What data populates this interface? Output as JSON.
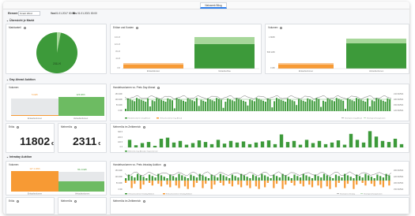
{
  "tab": {
    "label": "Netzwerk Bilog"
  },
  "filter": {
    "label": "Element",
    "value": "Smart Wind",
    "von_label": "Von",
    "von": "01.01.2017 00:00",
    "bis_label": "Bis",
    "bis": "01.01.2021 00:00"
  },
  "sections": {
    "overview": "Übersicht je Markt",
    "dayahead": "Day Ahead Auktion",
    "intraday": "Intraday Auktion"
  },
  "overview": {
    "marktanteil_title": "Marktanteil",
    "pie_label": "2311 €",
    "erloese_title": "Erlöse und Kosten",
    "volumen_title": "Volumen"
  },
  "dayahead": {
    "volumen_title": "Volumen",
    "handels_title": "Handelsvolumen vs. Preis Day Ahead",
    "erloes_title": "Erlös",
    "erloes_value": "11802",
    "mehrerloes_title": "Mehrerlös",
    "mehrerloes_value": "2311",
    "zeitbereich_title": "Mehrerlös im Zeitbereich"
  },
  "intraday": {
    "volumen_title": "Volumen",
    "handels_title": "Handelsvolumen vs. Preis Intraday Auktion",
    "erloes_title": "Erlös",
    "mehrerloes_title": "Mehrerlös",
    "zeitbereich_title": "Mehrerlös im Zeitbereich"
  },
  "currency": "€",
  "colors": {
    "green": "#3d9a3a",
    "green_light": "#a7d79a",
    "orange": "#f79a34",
    "orange_light": "#f9c690",
    "accent": "#2f80ed"
  },
  "chart_data": [
    {
      "type": "pie",
      "panel": "Marktanteil",
      "values": [
        97,
        3
      ],
      "colors": [
        "#3d9a3a",
        "#a7d79a"
      ],
      "label": "2311 €"
    },
    {
      "type": "bar",
      "panel": "Erlöse und Kosten",
      "categories": [
        "Einkaufskosten",
        "Verkaufserlöse"
      ],
      "ylim": [
        0,
        13000
      ],
      "series": [
        {
          "values": [
            1800,
            11802
          ]
        },
        {
          "values": [
            2600,
            14113
          ]
        }
      ]
    },
    {
      "type": "bar",
      "panel": "Volumen",
      "categories": [
        "Einkaufsvolumen",
        "Verkaufsvolumen"
      ],
      "ylim": [
        0,
        1000
      ],
      "series": [
        {
          "values": [
            130,
            800
          ]
        },
        {
          "values": [
            180,
            930
          ]
        }
      ]
    },
    {
      "type": "bar",
      "panel": "Volumen Day Ahead",
      "categories": [
        "Einkaufsvolumen",
        "Verkaufsvolumen"
      ],
      "ylim": [
        0,
        140
      ],
      "values": [
        5,
        120
      ],
      "data_labels": [
        "5 kWh",
        "123 kWh"
      ]
    },
    {
      "type": "bar",
      "panel": "Volumen Intraday",
      "categories": [
        "Einkaufsvolumen",
        "Verkaufsvolumen"
      ],
      "ylim": [
        0,
        140
      ],
      "values": [
        117,
        55
      ],
      "data_labels": [
        "117.1 kWh",
        "55.2 kWh"
      ]
    },
    {
      "type": "bar",
      "panel": "Mehrerlös im Zeitbereich Day Ahead",
      "values": [
        14,
        4,
        8,
        10,
        3,
        16,
        18,
        9,
        12,
        5,
        8,
        13,
        10,
        6,
        14,
        7,
        12,
        9,
        11,
        6,
        9,
        11,
        13,
        6,
        24,
        10,
        12,
        5,
        14,
        8,
        12,
        6,
        9,
        13,
        5,
        25,
        14,
        9,
        30,
        20,
        12,
        10,
        16,
        6
      ]
    }
  ]
}
